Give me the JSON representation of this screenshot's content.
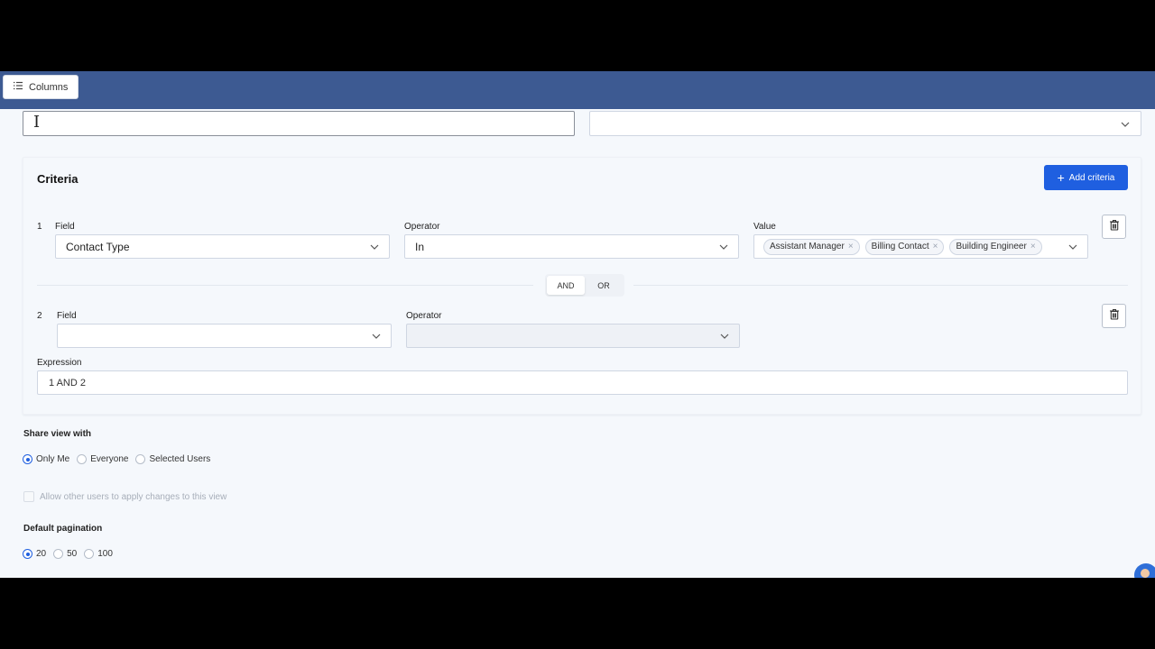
{
  "toolbar": {
    "columns_label": "Columns"
  },
  "view_name": {
    "value": ""
  },
  "criteria": {
    "title": "Criteria",
    "add_label": "Add criteria",
    "rows": [
      {
        "index": "1",
        "field_label": "Field",
        "field_value": "Contact Type",
        "operator_label": "Operator",
        "operator_value": "In",
        "value_label": "Value",
        "value_tags": [
          "Assistant Manager",
          "Billing Contact",
          "Building Engineer"
        ]
      },
      {
        "index": "2",
        "field_label": "Field",
        "field_value": "",
        "operator_label": "Operator",
        "operator_value": ""
      }
    ],
    "connector": {
      "and": "AND",
      "or": "OR",
      "selected": "AND"
    },
    "expression_label": "Expression",
    "expression_value": "1 AND 2"
  },
  "share": {
    "label": "Share view with",
    "options": [
      "Only Me",
      "Everyone",
      "Selected Users"
    ],
    "selected": "Only Me",
    "allow_changes_label": "Allow other users to apply changes to this view"
  },
  "pagination": {
    "label": "Default pagination",
    "options": [
      "20",
      "50",
      "100"
    ],
    "selected": "20"
  },
  "colors": {
    "header": "#3d5a92",
    "primary": "#1f5fe0",
    "background": "#f5f8fc"
  }
}
